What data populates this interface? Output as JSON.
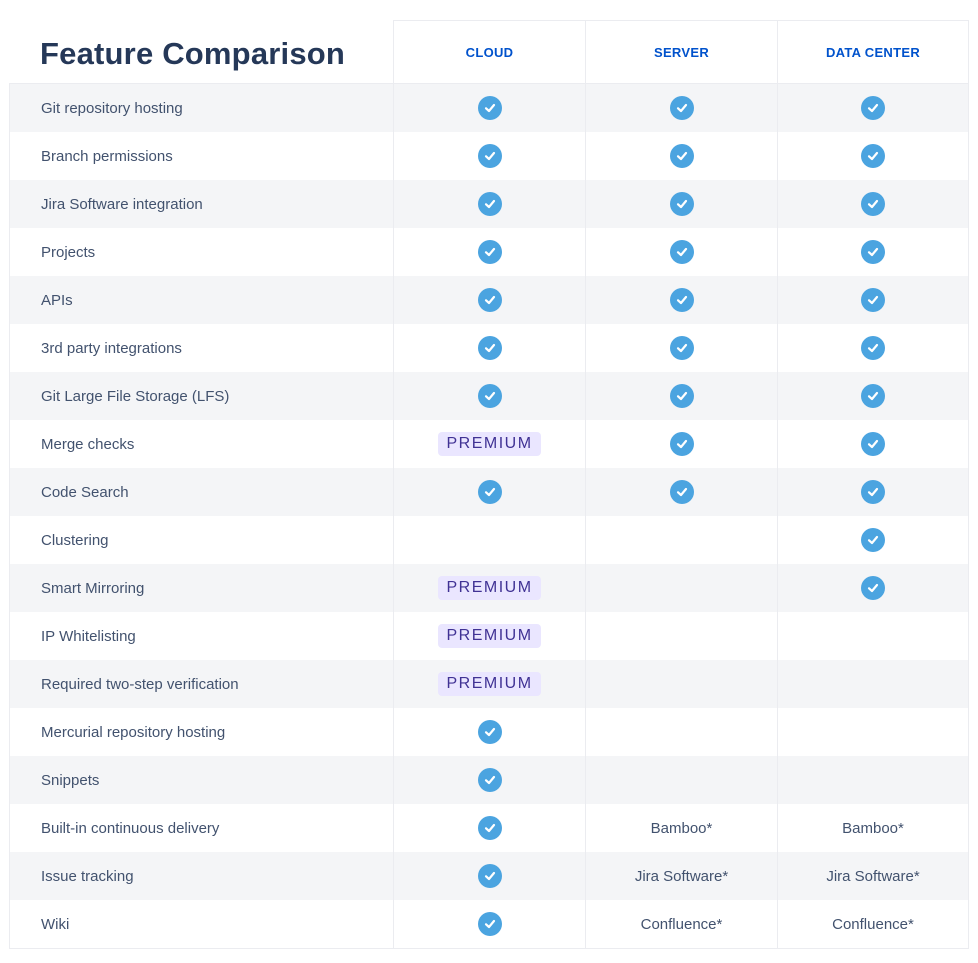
{
  "title": "Feature Comparison",
  "columns": [
    "CLOUD",
    "SERVER",
    "DATA CENTER"
  ],
  "premium_label": "PREMIUM",
  "rows": [
    {
      "feature": "Git repository hosting",
      "values": [
        "check",
        "check",
        "check"
      ]
    },
    {
      "feature": "Branch permissions",
      "values": [
        "check",
        "check",
        "check"
      ]
    },
    {
      "feature": "Jira Software integration",
      "values": [
        "check",
        "check",
        "check"
      ]
    },
    {
      "feature": "Projects",
      "values": [
        "check",
        "check",
        "check"
      ]
    },
    {
      "feature": "APIs",
      "values": [
        "check",
        "check",
        "check"
      ]
    },
    {
      "feature": "3rd party integrations",
      "values": [
        "check",
        "check",
        "check"
      ]
    },
    {
      "feature": "Git Large File Storage (LFS)",
      "values": [
        "check",
        "check",
        "check"
      ]
    },
    {
      "feature": "Merge checks",
      "values": [
        "premium",
        "check",
        "check"
      ]
    },
    {
      "feature": "Code Search",
      "values": [
        "check",
        "check",
        "check"
      ]
    },
    {
      "feature": "Clustering",
      "values": [
        "",
        "",
        "check"
      ]
    },
    {
      "feature": "Smart Mirroring",
      "values": [
        "premium",
        "",
        "check"
      ]
    },
    {
      "feature": "IP Whitelisting",
      "values": [
        "premium",
        "",
        ""
      ]
    },
    {
      "feature": "Required two-step verification",
      "values": [
        "premium",
        "",
        ""
      ]
    },
    {
      "feature": "Mercurial repository hosting",
      "values": [
        "check",
        "",
        ""
      ]
    },
    {
      "feature": "Snippets",
      "values": [
        "check",
        "",
        ""
      ]
    },
    {
      "feature": "Built-in continuous delivery",
      "values": [
        "check",
        "Bamboo*",
        "Bamboo*"
      ]
    },
    {
      "feature": "Issue tracking",
      "values": [
        "check",
        "Jira Software*",
        "Jira Software*"
      ]
    },
    {
      "feature": "Wiki",
      "values": [
        "check",
        "Confluence*",
        "Confluence*"
      ]
    }
  ],
  "colors": {
    "accent": "#0052cc",
    "check": "#4ba4e0",
    "premium_bg": "#eae6ff",
    "premium_text": "#403294",
    "title": "#253858"
  }
}
